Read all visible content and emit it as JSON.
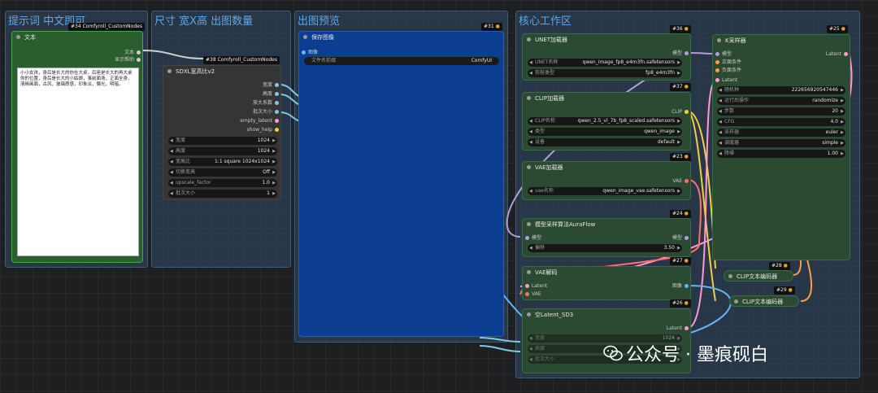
{
  "groups": {
    "prompt": "提示词 中文即可",
    "size": "尺寸 宽X高 出图数量",
    "preview": "出图预览",
    "core": "核心工作区"
  },
  "text_node": {
    "badge": "#34 Comfyroll_CustomNodes",
    "title": "文本",
    "out_text": "文本",
    "out_help": "显示帮助",
    "prompt": "小小女孩，身后是长大的你在大桌，后座是长大的再大桌你的位置，身后是长大的小姑娘，事前面场，正面全身，清晰画面，古风，玻璃质感，印象派，懒光，明暗。"
  },
  "sdxl_node": {
    "badge": "#38 Comfyroll_CustomNodes",
    "title": "SDXL宽高比v2",
    "outputs": [
      "宽度",
      "高度",
      "放大系数",
      "批次大小",
      "empty_latent",
      "show_help"
    ],
    "widgets": [
      {
        "label": "宽度",
        "value": "1024"
      },
      {
        "label": "高度",
        "value": "1024"
      },
      {
        "label": "宽高比",
        "value": "1:1 square 1024x1024"
      },
      {
        "label": "切换宽高",
        "value": "Off"
      },
      {
        "label": "upscale_factor",
        "value": "1.0"
      },
      {
        "label": "批次大小",
        "value": "1"
      }
    ]
  },
  "save_node": {
    "badge": "#31",
    "title": "保存图像",
    "input": "图像",
    "widget_label": "文件名前缀",
    "widget_value": "ComfyUI"
  },
  "unet_node": {
    "badge": "#36",
    "title": "UNET加载器",
    "out": "模型",
    "widgets": [
      {
        "label": "UNET名称",
        "value": "qwen_image_fp8_e4m3fn.safetensors"
      },
      {
        "label": "剪枝类型",
        "value": "fp8_e4m3fn"
      }
    ]
  },
  "clip_node": {
    "badge": "#37",
    "title": "CLIP加载器",
    "out": "CLIP",
    "widgets": [
      {
        "label": "CLIP名称",
        "value": "qwen_2.5_vl_7b_fp8_scaled.safetensors"
      },
      {
        "label": "类型",
        "value": "qwen_image"
      },
      {
        "label": "设备",
        "value": "default"
      }
    ]
  },
  "vae_loader": {
    "badge": "#23",
    "title": "VAE加载器",
    "out": "VAE",
    "widgets": [
      {
        "label": "vae名称",
        "value": "qwen_image_vae.safetensors"
      }
    ]
  },
  "sampling_node": {
    "badge": "#24",
    "title": "模型采样算法AuraFlow",
    "in": "模型",
    "out": "模型",
    "widgets": [
      {
        "label": "偏移",
        "value": "3.50"
      }
    ]
  },
  "vae_decode": {
    "badge": "#27",
    "title": "VAE解码",
    "in1": "Latent",
    "in2": "VAE",
    "out": "图像"
  },
  "latent_node": {
    "badge": "#26",
    "title": "空Latent_SD3",
    "out": "Latent",
    "widgets": [
      {
        "label": "宽度",
        "value": "1024"
      },
      {
        "label": "高度",
        "value": ""
      },
      {
        "label": "批次大小",
        "value": ""
      }
    ]
  },
  "ksampler": {
    "badge": "#25",
    "title": "K采样器",
    "inputs": [
      "模型",
      "正面条件",
      "负面条件",
      "Latent"
    ],
    "out": "Latent",
    "widgets": [
      {
        "label": "随机种",
        "value": "222656920547446"
      },
      {
        "label": "运行后操作",
        "value": "randomize"
      },
      {
        "label": "步数",
        "value": "20"
      },
      {
        "label": "CFG",
        "value": "4.0"
      },
      {
        "label": "采样器",
        "value": "euler"
      },
      {
        "label": "调度器",
        "value": "simple"
      },
      {
        "label": "降噪",
        "value": "1.00"
      }
    ]
  },
  "clip_encode_a": {
    "badge": "#28",
    "title": "CLIP文本编码器"
  },
  "clip_encode_b": {
    "badge": "#29",
    "title": "CLIP文本编码器"
  },
  "watermark": "公众号 · 墨痕砚白",
  "colors": {
    "model": "#b39ddb",
    "clip": "#f0d040",
    "vae": "#ff6f6f",
    "latent": "#ff9bd0",
    "image": "#64b5f6",
    "conditioning": "#ffa040",
    "int": "#7ec8e3"
  }
}
